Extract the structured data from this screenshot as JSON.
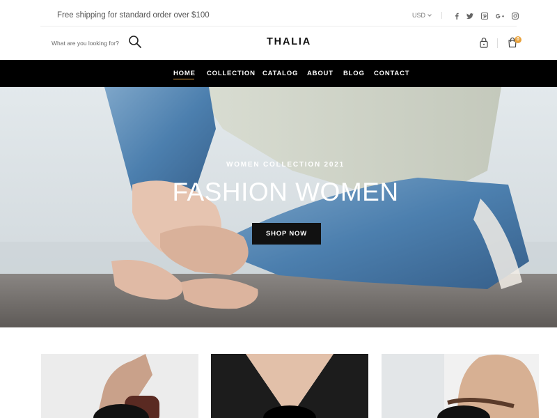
{
  "topbar": {
    "shipping_text": "Free shipping for standard order over $100",
    "currency": "USD",
    "social_icons": [
      "facebook-icon",
      "twitter-icon",
      "pinterest-icon",
      "google-plus-icon",
      "instagram-icon"
    ]
  },
  "header": {
    "search_placeholder": "What are you looking for?",
    "logo": "THALIA",
    "cart_count": "0",
    "accent_color": "#e9a23b"
  },
  "nav": {
    "items": [
      "HOME",
      "COLLECTION",
      "CATALOG",
      "ABOUT",
      "BLOG",
      "CONTACT"
    ],
    "active": "HOME"
  },
  "hero": {
    "subtitle": "WOMEN COLLECTION 2021",
    "title": "FASHION WOMEN",
    "button_label": "SHOP NOW"
  },
  "products": {
    "cards": [
      "product-card-1",
      "product-card-2",
      "product-card-3"
    ]
  }
}
